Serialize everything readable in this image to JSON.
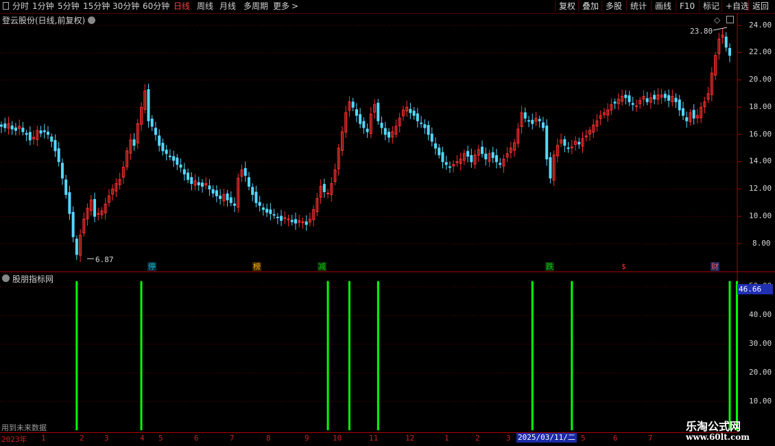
{
  "toolbar": {
    "periods": [
      "分时",
      "1分钟",
      "5分钟",
      "15分钟",
      "30分钟",
      "60分钟",
      "日线",
      "周线",
      "月线",
      "多周期",
      "更多"
    ],
    "active_period": "日线",
    "right_buttons": [
      "复权",
      "叠加",
      "多股",
      "统计",
      "画线",
      "F10",
      "标记",
      "+自选",
      "返回"
    ]
  },
  "main_panel": {
    "title": "登云股份(日线,前复权)",
    "y_ticks": [
      "24.00",
      "22.00",
      "20.00",
      "18.00",
      "16.00",
      "14.00",
      "12.00",
      "10.00",
      "8.00"
    ],
    "high_label": "23.80",
    "low_label": "6.87",
    "event_tags": [
      {
        "text": "停",
        "color": "#00c0c0"
      },
      {
        "text": "榜",
        "color": "#ffb000"
      },
      {
        "text": "减",
        "color": "#00c000"
      },
      {
        "text": "跌",
        "color": "#00c000"
      },
      {
        "text": "$",
        "color": "#ff3030"
      },
      {
        "text": "财",
        "color": "#ff4040"
      }
    ]
  },
  "indicator_panel": {
    "title": "股朋指标网",
    "y_ticks": [
      "50.00",
      "40.00",
      "30.00",
      "20.00",
      "10.00"
    ],
    "current_value": "46.66",
    "note": "用到未来数据"
  },
  "date_axis": {
    "labels": [
      "2023年",
      "1",
      "2",
      "3",
      "4",
      "5",
      "6",
      "7",
      "8",
      "9",
      "10",
      "11",
      "12",
      "1",
      "2",
      "3",
      "5",
      "6",
      "7"
    ],
    "highlight": "2025/03/11/二"
  },
  "watermark": {
    "line1": "乐淘公式网",
    "line2": "www.60lt.com"
  },
  "colors": {
    "up": "#ff3030",
    "down": "#54d8ff",
    "signal": "#00ff00",
    "grid": "#7a0000"
  },
  "chart_data": {
    "type": "candlestick",
    "ylim": [
      7.0,
      24.5
    ],
    "indicator_ylim": [
      0,
      55
    ],
    "closes": [
      16.6,
      16.5,
      16.8,
      16.4,
      16.3,
      16.6,
      16.2,
      16.0,
      15.6,
      15.8,
      16.3,
      16.1,
      16.2,
      16.0,
      15.5,
      14.8,
      14.0,
      12.8,
      11.6,
      10.2,
      8.5,
      7.2,
      8.6,
      9.8,
      10.6,
      11.2,
      10.0,
      10.2,
      10.4,
      10.9,
      11.5,
      12.0,
      12.4,
      12.7,
      13.6,
      14.8,
      15.6,
      15.2,
      16.8,
      18.0,
      19.2,
      17.0,
      16.6,
      16.0,
      15.2,
      14.8,
      14.6,
      14.4,
      14.1,
      13.8,
      13.6,
      13.1,
      12.7,
      12.4,
      12.6,
      12.3,
      12.2,
      12.4,
      12.0,
      11.7,
      11.5,
      11.3,
      11.6,
      11.2,
      11.0,
      10.8,
      12.8,
      13.4,
      13.0,
      12.2,
      11.6,
      11.0,
      10.8,
      10.5,
      10.3,
      10.2,
      10.1,
      9.9,
      9.7,
      9.9,
      9.8,
      9.6,
      9.5,
      9.7,
      9.6,
      9.4,
      9.8,
      10.5,
      11.3,
      12.2,
      11.8,
      11.7,
      12.4,
      13.4,
      15.0,
      16.2,
      17.6,
      18.4,
      18.0,
      17.4,
      16.8,
      16.5,
      16.2,
      17.5,
      18.2,
      17.0,
      16.5,
      16.0,
      15.8,
      16.2,
      16.6,
      17.2,
      17.8,
      18.0,
      17.6,
      17.4,
      17.0,
      16.8,
      16.5,
      16.0,
      15.5,
      15.0,
      14.5,
      14.0,
      13.8,
      13.6,
      13.8,
      14.0,
      14.2,
      14.6,
      14.4,
      14.0,
      14.5,
      14.9,
      14.6,
      14.2,
      14.6,
      14.3,
      14.0,
      13.8,
      14.2,
      14.6,
      15.0,
      15.4,
      16.4,
      17.6,
      17.2,
      17.0,
      16.8,
      17.2,
      17.0,
      16.5,
      14.2,
      12.8,
      14.5,
      15.2,
      15.6,
      15.2,
      15.0,
      15.1,
      15.5,
      15.3,
      15.7,
      15.9,
      16.3,
      16.7,
      17.0,
      17.4,
      17.6,
      17.8,
      18.2,
      18.3,
      18.6,
      18.8,
      18.7,
      18.4,
      18.2,
      18.1,
      18.5,
      18.8,
      18.4,
      18.7,
      18.6,
      18.9,
      18.9,
      18.7,
      18.5,
      18.8,
      18.4,
      17.8,
      17.4,
      17.0,
      17.6,
      17.2,
      17.4,
      18.0,
      18.4,
      19.0,
      20.5,
      21.8,
      23.0,
      23.3,
      22.4,
      21.8
    ],
    "indicator_signals": [
      {
        "bar": 21,
        "value": 52
      },
      {
        "bar": 39,
        "value": 52
      },
      {
        "bar": 91,
        "value": 52
      },
      {
        "bar": 97,
        "value": 52
      },
      {
        "bar": 105,
        "value": 52
      },
      {
        "bar": 148,
        "value": 52
      },
      {
        "bar": 159,
        "value": 52
      },
      {
        "bar": 203,
        "value": 52
      },
      {
        "bar": 205,
        "value": 52
      }
    ]
  }
}
